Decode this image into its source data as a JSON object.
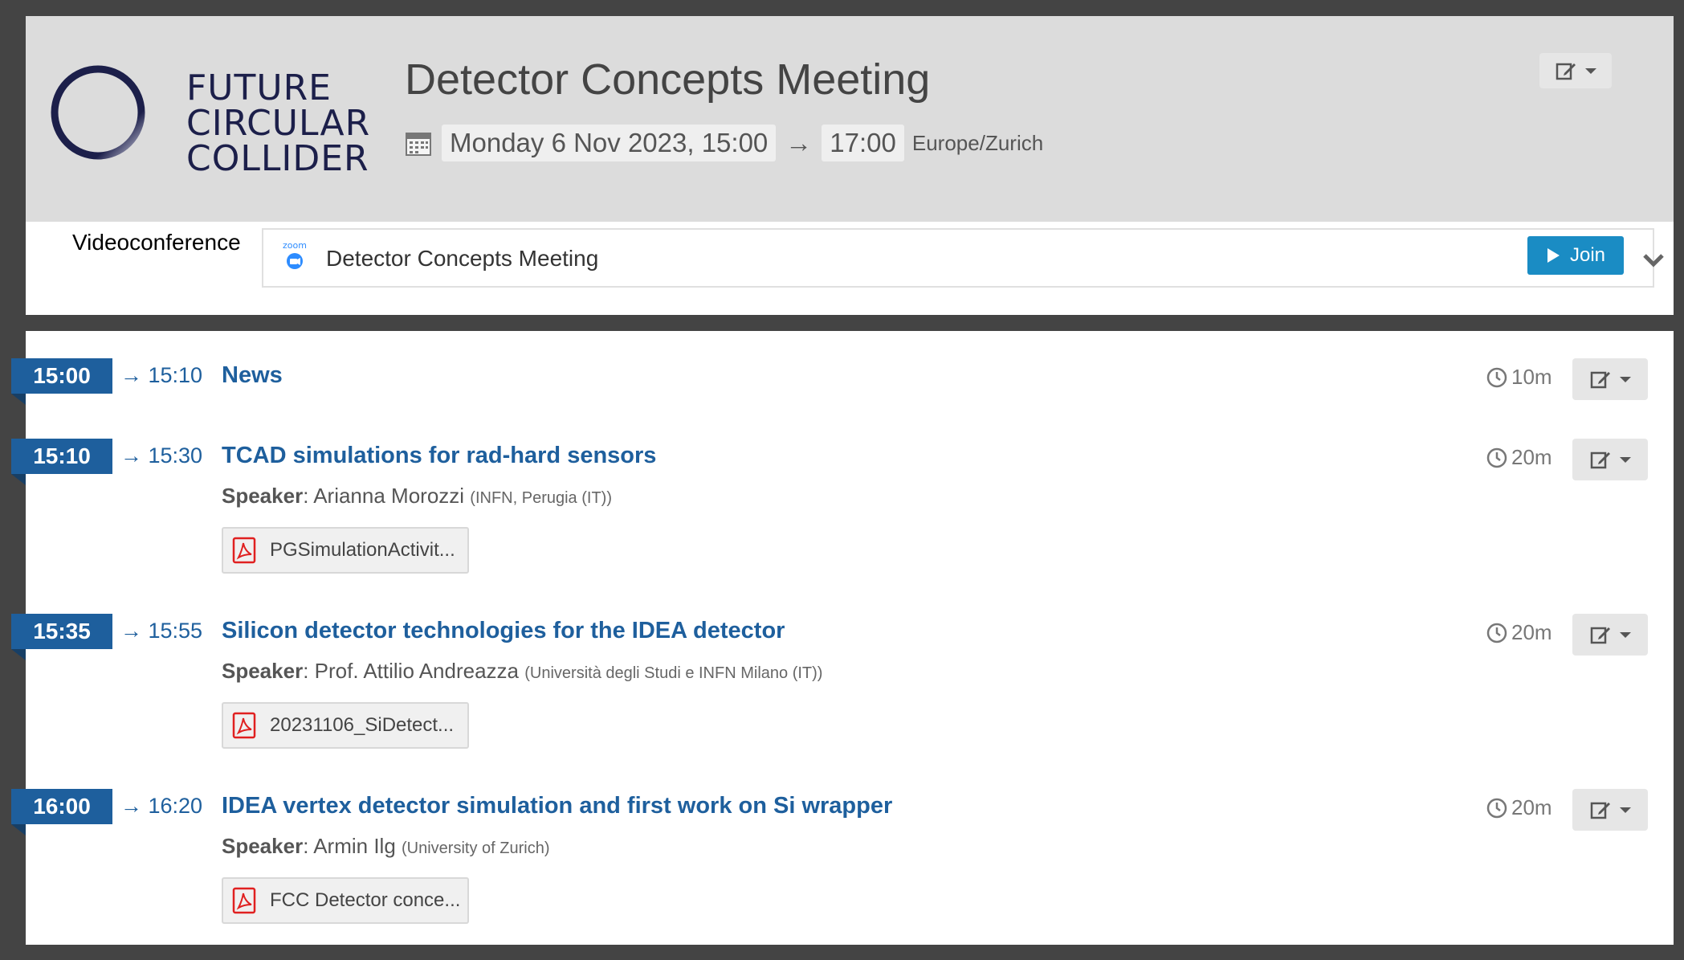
{
  "header": {
    "logo": {
      "lines": [
        "FUTURE",
        "CIRCULAR",
        "COLLIDER"
      ]
    },
    "title": "Detector Concepts Meeting",
    "date": {
      "start": "Monday 6 Nov 2023, 15:00",
      "arrow": "→",
      "end": "17:00",
      "timezone": "Europe/Zurich"
    },
    "manage_icon": "edit-icon"
  },
  "videoconference": {
    "label": "Videoconference",
    "provider_icon": "zoom-icon",
    "room_name": "Detector Concepts Meeting",
    "join_label": "Join"
  },
  "timetable": {
    "entries": [
      {
        "start": "15:00",
        "end": "→ 15:10",
        "title": "News",
        "duration": "10m"
      },
      {
        "start": "15:10",
        "end": "→ 15:30",
        "title": "TCAD simulations for rad-hard sensors",
        "speaker_label": "Speaker",
        "speaker_name": ": Arianna Morozzi",
        "affiliation": "(INFN, Perugia (IT))",
        "attachment": "PGSimulationActivit...",
        "duration": "20m"
      },
      {
        "start": "15:35",
        "end": "→ 15:55",
        "title": "Silicon detector technologies for the IDEA detector",
        "speaker_label": "Speaker",
        "speaker_name": ": Prof. Attilio Andreazza",
        "affiliation": "(Università degli Studi e INFN Milano (IT))",
        "attachment": "20231106_SiDetect...",
        "duration": "20m"
      },
      {
        "start": "16:00",
        "end": "→ 16:20",
        "title": "IDEA vertex detector simulation and first work on Si wrapper",
        "speaker_label": "Speaker",
        "speaker_name": ": Armin Ilg",
        "affiliation": "(University of Zurich)",
        "attachment": "FCC Detector conce...",
        "duration": "20m"
      }
    ]
  },
  "colors": {
    "accent": "#1e5f9d",
    "join": "#1a8cc4",
    "header_bg": "#dcdcdc",
    "pdf": "#e02020"
  }
}
